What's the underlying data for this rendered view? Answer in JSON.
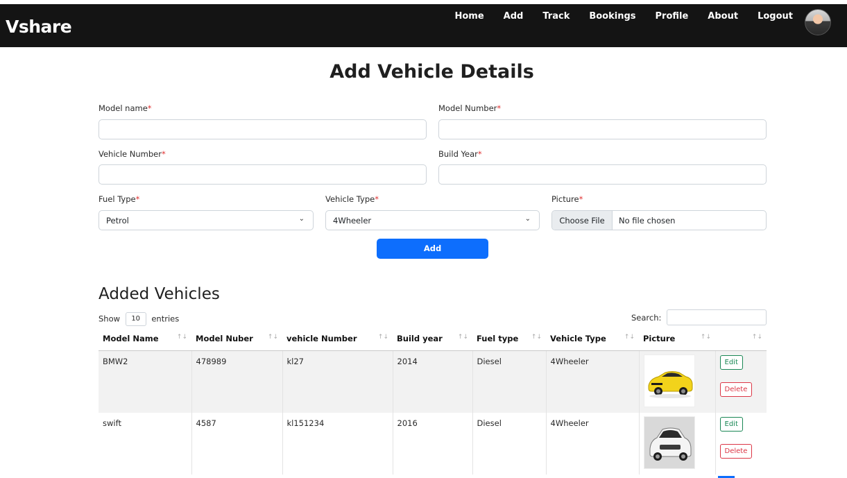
{
  "app": {
    "brand": "Vshare"
  },
  "nav": {
    "items": [
      "Home",
      "Add",
      "Track",
      "Bookings",
      "Profile",
      "About",
      "Logout"
    ]
  },
  "form": {
    "title": "Add Vehicle Details",
    "model_name_label": "Model name",
    "model_number_label": "Model Number",
    "vehicle_number_label": "Vehicle Number",
    "build_year_label": "Build Year",
    "fuel_type_label": "Fuel Type",
    "vehicle_type_label": "Vehicle Type",
    "picture_label": "Picture",
    "required_mark": "*",
    "fuel_type_value": "Petrol",
    "vehicle_type_value": "4Wheeler",
    "file_button": "Choose File",
    "file_status": "No file chosen",
    "submit_label": "Add"
  },
  "vehicles": {
    "title": "Added Vehicles",
    "show_prefix": "Show",
    "show_value": "10",
    "show_suffix": "entries",
    "search_label": "Search:",
    "sort_glyph": "↑↓",
    "columns": [
      "Model Name",
      "Model Nuber",
      "vehicle Number",
      "Build year",
      "Fuel type",
      "Vehicle Type",
      "Picture",
      ""
    ],
    "rows": [
      {
        "model_name": "BMW2",
        "model_number": "478989",
        "vehicle_number": "kl27",
        "build_year": "2014",
        "fuel_type": "Diesel",
        "vehicle_type": "4Wheeler",
        "picture": "yellow-sports-car-image",
        "edit": "Edit",
        "delete": "Delete"
      },
      {
        "model_name": "swift",
        "model_number": "4587",
        "vehicle_number": "kl151234",
        "build_year": "2016",
        "fuel_type": "Diesel",
        "vehicle_type": "4Wheeler",
        "picture": "white-hatchback-car-image",
        "edit": "Edit",
        "delete": "Delete"
      }
    ]
  },
  "colors": {
    "navbar": "#141414",
    "primary": "#0d6efd",
    "success": "#198754",
    "danger": "#dc3545",
    "required": "#e03131"
  }
}
